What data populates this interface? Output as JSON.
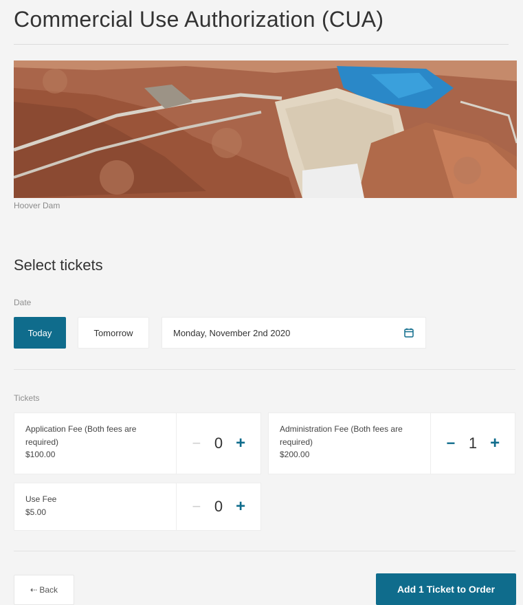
{
  "page": {
    "title": "Commercial Use Authorization (CUA)",
    "image_caption": "Hoover Dam"
  },
  "tickets_section": {
    "title": "Select tickets",
    "date_label": "Date",
    "today_label": "Today",
    "tomorrow_label": "Tomorrow",
    "selected_date": "Monday, November 2nd 2020",
    "tickets_label": "Tickets"
  },
  "tickets": [
    {
      "name": "Application Fee (Both fees are required)",
      "price": "$100.00",
      "quantity": "0"
    },
    {
      "name": "Administration Fee (Both fees are required)",
      "price": "$200.00",
      "quantity": "1"
    },
    {
      "name": "Use Fee",
      "price": "$5.00",
      "quantity": "0"
    }
  ],
  "stepper": {
    "minus": "−",
    "plus": "+"
  },
  "footer": {
    "back_label": "⇠ Back",
    "add_label": "Add 1 Ticket to Order"
  },
  "colors": {
    "accent": "#0f6c8c",
    "background": "#f4f4f4"
  },
  "icons": [
    "calendar-icon",
    "back-arrow-icon",
    "minus-icon",
    "plus-icon"
  ]
}
